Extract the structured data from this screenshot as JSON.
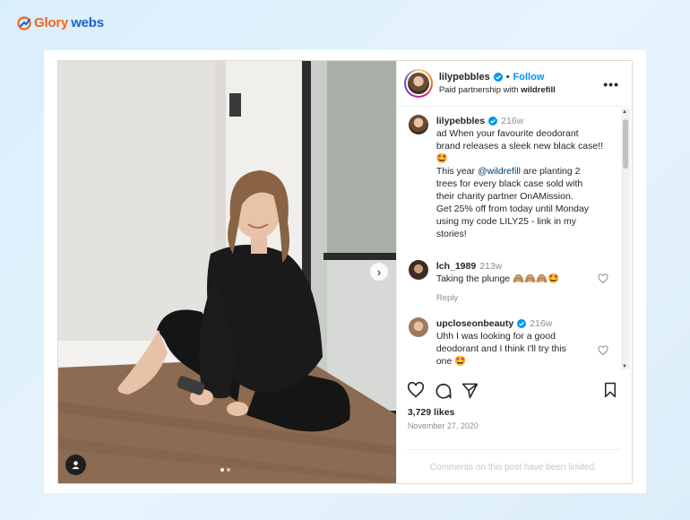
{
  "brand": {
    "part1": "Glory",
    "part2": "webs"
  },
  "post": {
    "username": "lilypebbles",
    "follow_label": "Follow",
    "separator": "•",
    "partnership_prefix": "Paid partnership with ",
    "partner": "wildrefill",
    "more_label": "•••",
    "caption": {
      "username": "lilypebbles",
      "time": "216w",
      "line1": "ad When your favourite deodorant",
      "line2": "brand releases a sleek new black case!!",
      "emoji1": "🤩",
      "line3_pre": "This year ",
      "mention": "@wildrefill",
      "line3_post": " are planting 2",
      "line4": "trees for every black case sold with",
      "line5": "their charity partner OnAMission.",
      "line6": "Get 25% off from today until Monday",
      "line7": "using my code LILY25 - link in my",
      "line8": "stories!"
    },
    "comments": [
      {
        "username": "lch_1989",
        "time": "213w",
        "text": "Taking the plunge 🙈🙈🙈🤩",
        "reply": "Reply"
      },
      {
        "username": "upcloseonbeauty",
        "time": "216w",
        "line1": "Uhh I was looking for a good",
        "line2": "deodorant and I think I'll try this",
        "line3": "one 🤩"
      }
    ],
    "likes": "3,729 likes",
    "date": "November 27, 2020",
    "comments_limited": "Comments on this post have been limited."
  },
  "colors": {
    "follow": "#0095f6",
    "brand_orange": "#f26522",
    "brand_blue": "#1f63c6",
    "verified": "#0095f6"
  },
  "icons": [
    "glorywebs-logo-icon",
    "verified-icon",
    "more-icon",
    "next-arrow-icon",
    "user-tag-icon",
    "heart-icon",
    "comment-icon",
    "share-icon",
    "bookmark-icon"
  ]
}
